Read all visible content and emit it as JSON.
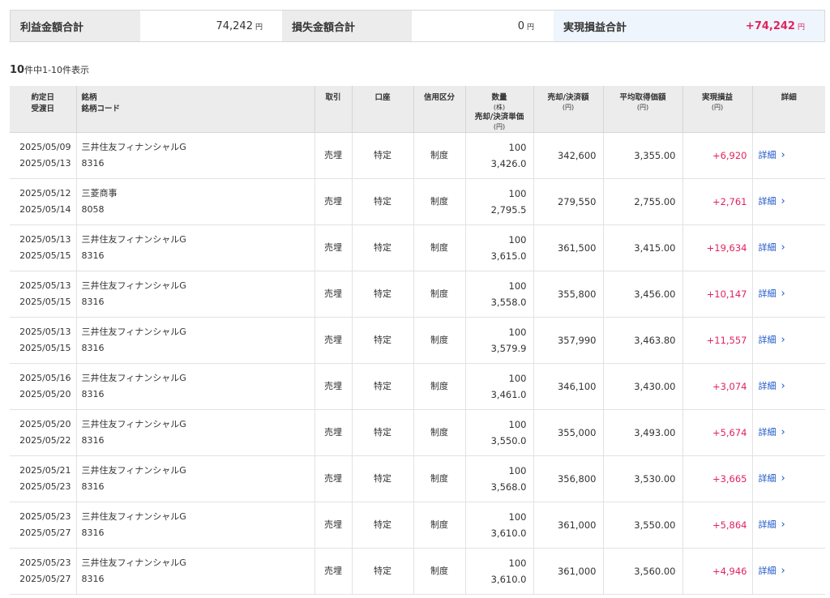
{
  "summary": {
    "profit_label": "利益金額合計",
    "profit_value": "74,242",
    "loss_label": "損失金額合計",
    "loss_value": "0",
    "realized_label": "実現損益合計",
    "realized_value": "+74,242",
    "unit": "円"
  },
  "count": {
    "total": "10",
    "text": "件中1-10件表示"
  },
  "headers": {
    "trade_date": "約定日",
    "settle_date": "受渡日",
    "stock": "銘柄",
    "code": "銘柄コード",
    "trade": "取引",
    "account": "口座",
    "credit": "信用区分",
    "qty": "数量",
    "qty_unit": "(株)",
    "unit_price": "売却/決済単価",
    "yen": "(円)",
    "amount": "売却/決済額",
    "avg_cost": "平均取得価額",
    "pl": "実現損益",
    "detail": "詳細"
  },
  "rows": [
    {
      "trade_date": "2025/05/09",
      "settle_date": "2025/05/13",
      "name": "三井住友フィナンシャルG",
      "code": "8316",
      "trade": "売埋",
      "account": "特定",
      "credit": "制度",
      "qty": "100",
      "price": "3,426.0",
      "amount": "342,600",
      "avg": "3,355.00",
      "pl": "+6,920",
      "detail": "詳細"
    },
    {
      "trade_date": "2025/05/12",
      "settle_date": "2025/05/14",
      "name": "三菱商事",
      "code": "8058",
      "trade": "売埋",
      "account": "特定",
      "credit": "制度",
      "qty": "100",
      "price": "2,795.5",
      "amount": "279,550",
      "avg": "2,755.00",
      "pl": "+2,761",
      "detail": "詳細"
    },
    {
      "trade_date": "2025/05/13",
      "settle_date": "2025/05/15",
      "name": "三井住友フィナンシャルG",
      "code": "8316",
      "trade": "売埋",
      "account": "特定",
      "credit": "制度",
      "qty": "100",
      "price": "3,615.0",
      "amount": "361,500",
      "avg": "3,415.00",
      "pl": "+19,634",
      "detail": "詳細"
    },
    {
      "trade_date": "2025/05/13",
      "settle_date": "2025/05/15",
      "name": "三井住友フィナンシャルG",
      "code": "8316",
      "trade": "売埋",
      "account": "特定",
      "credit": "制度",
      "qty": "100",
      "price": "3,558.0",
      "amount": "355,800",
      "avg": "3,456.00",
      "pl": "+10,147",
      "detail": "詳細"
    },
    {
      "trade_date": "2025/05/13",
      "settle_date": "2025/05/15",
      "name": "三井住友フィナンシャルG",
      "code": "8316",
      "trade": "売埋",
      "account": "特定",
      "credit": "制度",
      "qty": "100",
      "price": "3,579.9",
      "amount": "357,990",
      "avg": "3,463.80",
      "pl": "+11,557",
      "detail": "詳細"
    },
    {
      "trade_date": "2025/05/16",
      "settle_date": "2025/05/20",
      "name": "三井住友フィナンシャルG",
      "code": "8316",
      "trade": "売埋",
      "account": "特定",
      "credit": "制度",
      "qty": "100",
      "price": "3,461.0",
      "amount": "346,100",
      "avg": "3,430.00",
      "pl": "+3,074",
      "detail": "詳細"
    },
    {
      "trade_date": "2025/05/20",
      "settle_date": "2025/05/22",
      "name": "三井住友フィナンシャルG",
      "code": "8316",
      "trade": "売埋",
      "account": "特定",
      "credit": "制度",
      "qty": "100",
      "price": "3,550.0",
      "amount": "355,000",
      "avg": "3,493.00",
      "pl": "+5,674",
      "detail": "詳細"
    },
    {
      "trade_date": "2025/05/21",
      "settle_date": "2025/05/23",
      "name": "三井住友フィナンシャルG",
      "code": "8316",
      "trade": "売埋",
      "account": "特定",
      "credit": "制度",
      "qty": "100",
      "price": "3,568.0",
      "amount": "356,800",
      "avg": "3,530.00",
      "pl": "+3,665",
      "detail": "詳細"
    },
    {
      "trade_date": "2025/05/23",
      "settle_date": "2025/05/27",
      "name": "三井住友フィナンシャルG",
      "code": "8316",
      "trade": "売埋",
      "account": "特定",
      "credit": "制度",
      "qty": "100",
      "price": "3,610.0",
      "amount": "361,000",
      "avg": "3,550.00",
      "pl": "+5,864",
      "detail": "詳細"
    },
    {
      "trade_date": "2025/05/23",
      "settle_date": "2025/05/27",
      "name": "三井住友フィナンシャルG",
      "code": "8316",
      "trade": "売埋",
      "account": "特定",
      "credit": "制度",
      "qty": "100",
      "price": "3,610.0",
      "amount": "361,000",
      "avg": "3,560.00",
      "pl": "+4,946",
      "detail": "詳細"
    }
  ],
  "colors": {
    "profit": "#e0245e",
    "link": "#1a56c9",
    "header_bg": "#ececec",
    "highlight_bg": "#eef5fd"
  },
  "icons": {
    "detail_chevron": "chevron-right-icon"
  }
}
